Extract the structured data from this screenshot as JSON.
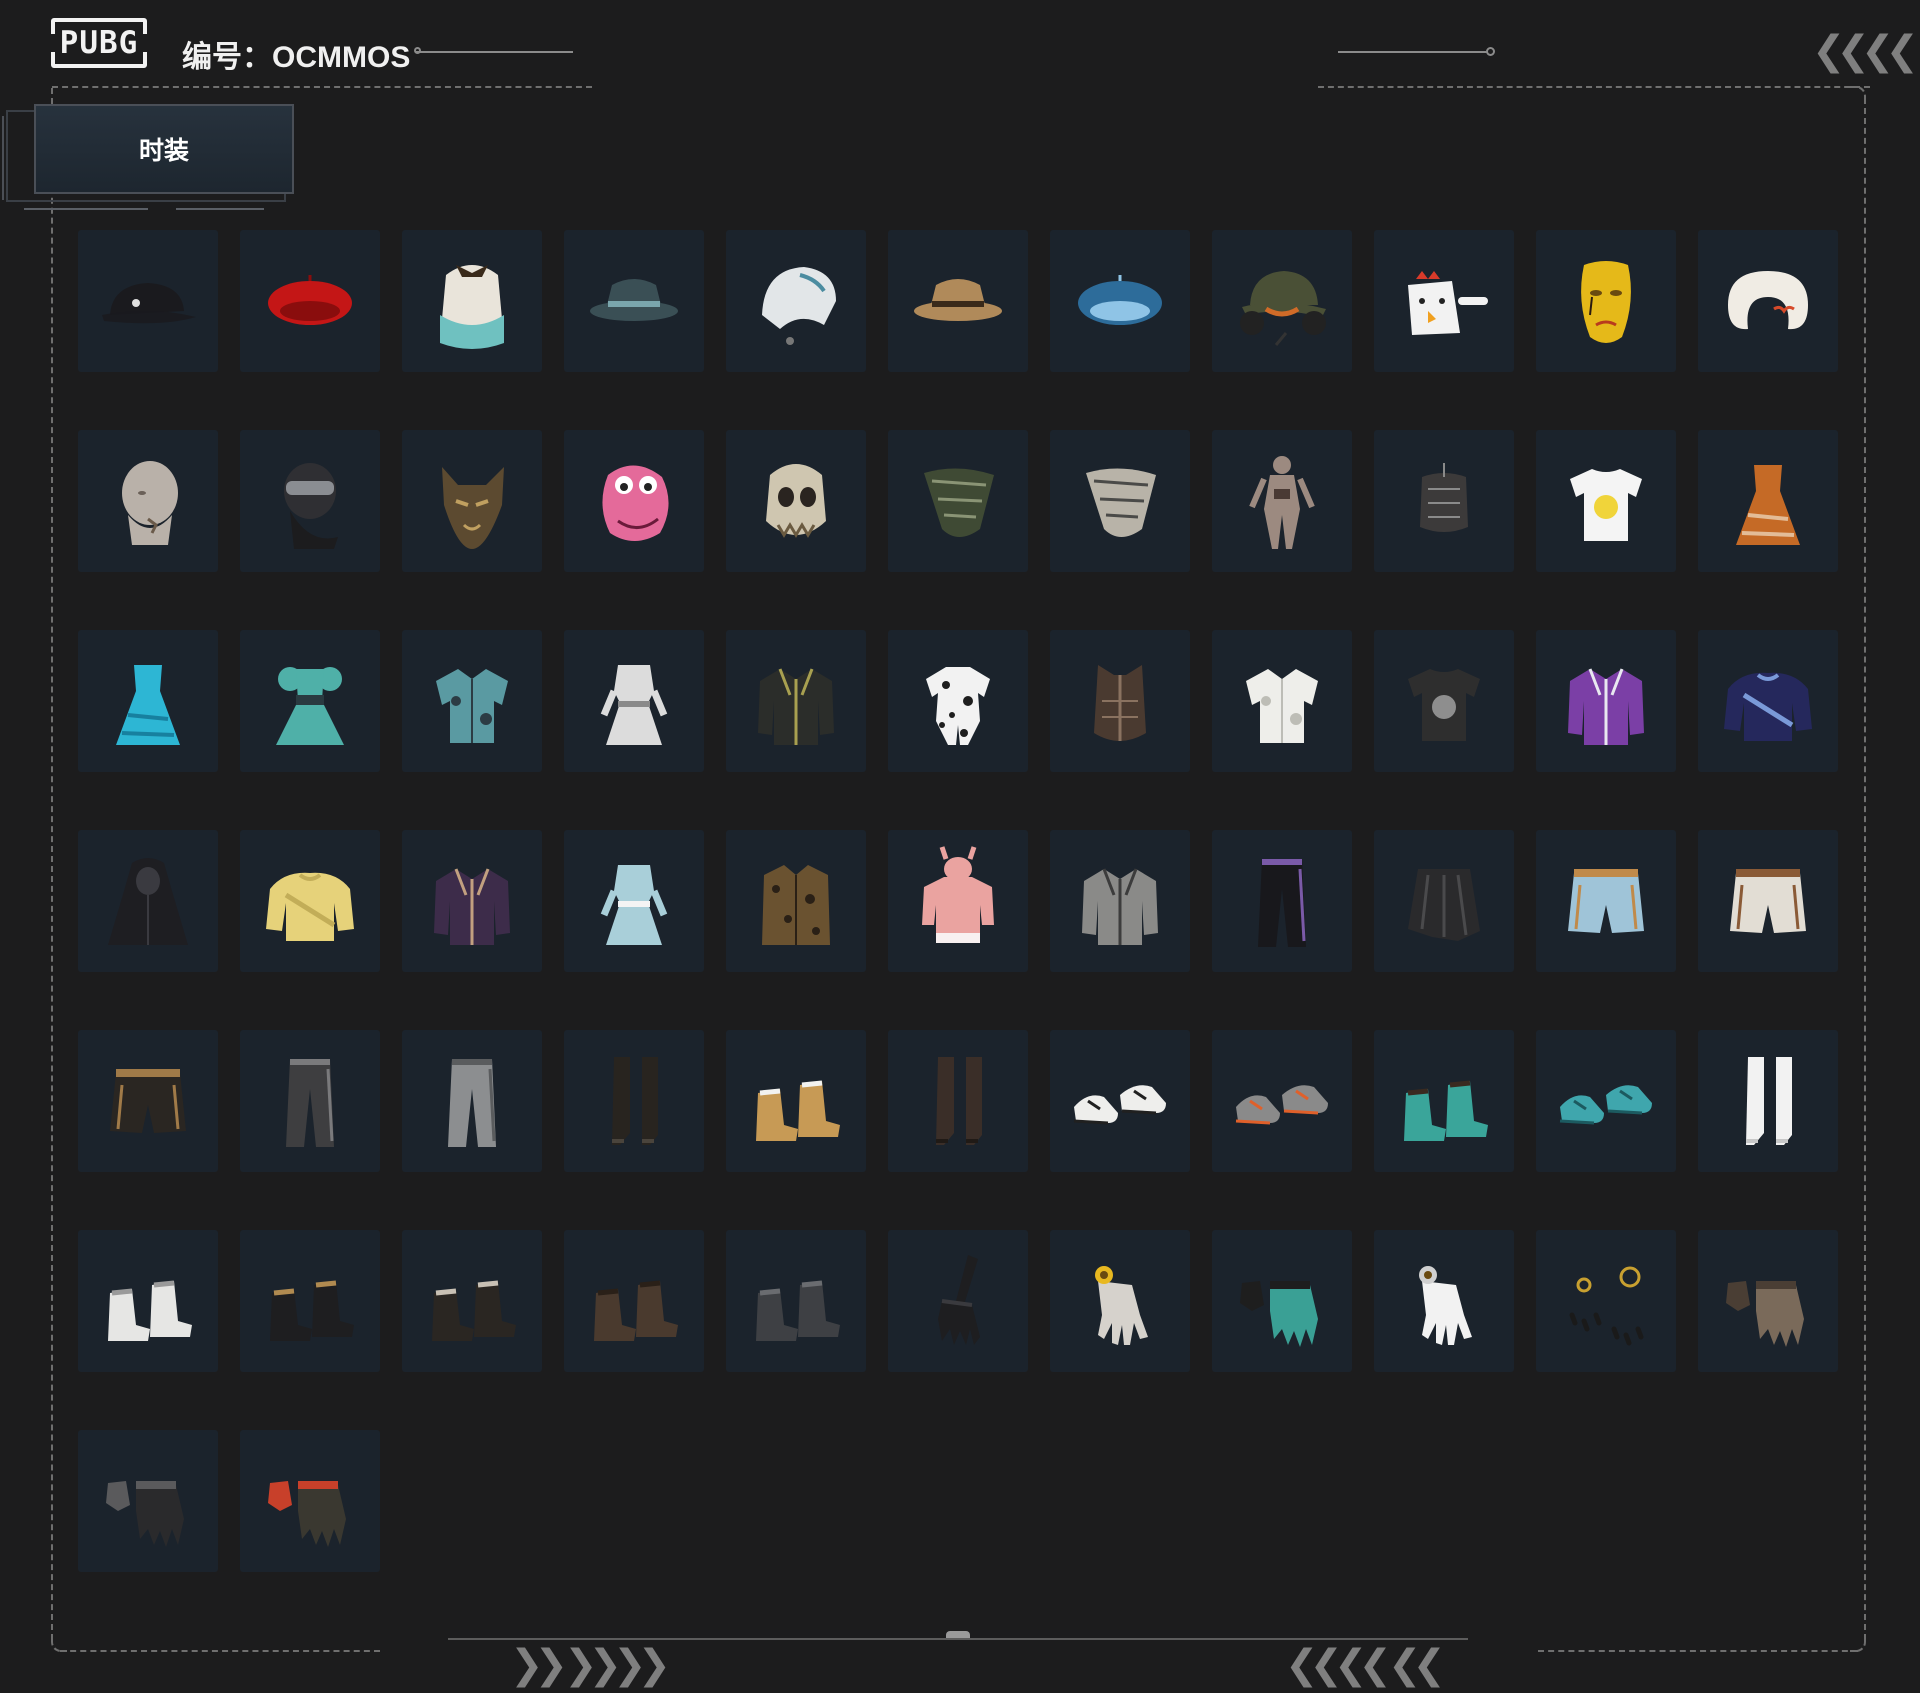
{
  "header": {
    "logo_text": "PUBG",
    "code_label": "编号：OCMMOS"
  },
  "category_tab": {
    "label": "时装"
  },
  "colors": {
    "background": "#1c1c1d",
    "tile": "#1b232c",
    "frame_dash": "#6f6f6f",
    "tab_gradient_top": "#27323d",
    "tab_gradient_bottom": "#1d262f"
  },
  "items": [
    {
      "name": "black-baseball-cap",
      "icon": "cap",
      "color": "#1a1a1e",
      "accent": "#e0e0e0"
    },
    {
      "name": "red-beret",
      "icon": "beret",
      "color": "#c41616",
      "accent": "#8a0d0d"
    },
    {
      "name": "teal-fluffy-hair-with-bow",
      "icon": "hair",
      "color": "#6fc1c0",
      "accent": "#e9e4da"
    },
    {
      "name": "teal-bucket-hat",
      "icon": "bucket",
      "color": "#3a4f55",
      "accent": "#7aa6ad"
    },
    {
      "name": "white-hood",
      "icon": "hood",
      "color": "#e2e6e8",
      "accent": "#4b8ca0"
    },
    {
      "name": "leopard-bucket-hat",
      "icon": "bucket",
      "color": "#b08a5a",
      "accent": "#3a2a1a"
    },
    {
      "name": "blue-plaid-beret",
      "icon": "beret",
      "color": "#2d6c9a",
      "accent": "#8fc4e6"
    },
    {
      "name": "army-cap-headset",
      "icon": "headset",
      "color": "#4a5036",
      "accent": "#d06b28"
    },
    {
      "name": "white-chicken-mask",
      "icon": "chicken",
      "color": "#f2f2f2",
      "accent": "#d83a2a"
    },
    {
      "name": "gold-face-mask",
      "icon": "mask",
      "color": "#e5b919",
      "accent": "#b83b1d"
    },
    {
      "name": "white-neck-pillow",
      "icon": "pillow",
      "color": "#f0ece4",
      "accent": "#d64a2a"
    },
    {
      "name": "bald-head-with-goatee",
      "icon": "head",
      "color": "#b9b1a9",
      "accent": "#6a5a4a"
    },
    {
      "name": "dark-goggles-balaclava",
      "icon": "balaclava",
      "color": "#2f2f33",
      "accent": "#8a8d92"
    },
    {
      "name": "bronze-wolf-mask",
      "icon": "wolf",
      "color": "#5c4a30",
      "accent": "#c0a060"
    },
    {
      "name": "pink-dino-mask",
      "icon": "dino",
      "color": "#e46a9a",
      "accent": "#ffffff"
    },
    {
      "name": "skeleton-warrior-mask",
      "icon": "skull",
      "color": "#cfc6b0",
      "accent": "#6a5a40"
    },
    {
      "name": "green-camo-bandana",
      "icon": "bandana",
      "color": "#3f4a34",
      "accent": "#8a9475"
    },
    {
      "name": "checkered-scarf",
      "icon": "bandana",
      "color": "#b8b3a8",
      "accent": "#4a4a48"
    },
    {
      "name": "hooded-bodysuit",
      "icon": "bodysuit",
      "color": "#9c8a80",
      "accent": "#4a3a34"
    },
    {
      "name": "dark-leather-corset",
      "icon": "corset",
      "color": "#3c3a3a",
      "accent": "#8a8a8a"
    },
    {
      "name": "white-chick-tshirt",
      "icon": "tshirt",
      "color": "#f4f4f4",
      "accent": "#f0d43a"
    },
    {
      "name": "orange-leopard-dress",
      "icon": "dress",
      "color": "#c56a26",
      "accent": "#f0e0c8"
    },
    {
      "name": "blue-tie-dye-dress",
      "icon": "dress",
      "color": "#2db6d4",
      "accent": "#0e6a8a"
    },
    {
      "name": "teal-puff-sleeve-dress",
      "icon": "puffdress",
      "color": "#4fb0a8",
      "accent": "#2a3a40"
    },
    {
      "name": "tropical-print-shirt",
      "icon": "shirt",
      "color": "#5a9aa2",
      "accent": "#2c3c44"
    },
    {
      "name": "white-sci-fi-dress",
      "icon": "scidress",
      "color": "#dcdcdc",
      "accent": "#8a8a8a"
    },
    {
      "name": "black-military-jacket",
      "icon": "jacket",
      "color": "#2b2d2a",
      "accent": "#a8a050"
    },
    {
      "name": "dalmatian-outfit",
      "icon": "romper",
      "color": "#f2f2f2",
      "accent": "#1e1e1e"
    },
    {
      "name": "brown-leather-vest",
      "icon": "vest",
      "color": "#4a3a30",
      "accent": "#8a7260"
    },
    {
      "name": "white-mandarin-shirt",
      "icon": "shirt",
      "color": "#eeeeea",
      "accent": "#bdbdb6"
    },
    {
      "name": "winner-winner-tshirt",
      "icon": "tshirt",
      "color": "#2e2e2e",
      "accent": "#8e8e8e"
    },
    {
      "name": "purple-colorblock-jacket",
      "icon": "jacket",
      "color": "#7b3fa6",
      "accent": "#e8e8f0"
    },
    {
      "name": "navy-anniversary-sweater",
      "icon": "sweater",
      "color": "#25285c",
      "accent": "#7a9ad8"
    },
    {
      "name": "black-hooded-cloak",
      "icon": "cloak",
      "color": "#1e1e22",
      "accent": "#3a3a40"
    },
    {
      "name": "yellow-fuzzy-sweater",
      "icon": "sweater",
      "color": "#e6d27a",
      "accent": "#c2ad58"
    },
    {
      "name": "purple-bomber-jacket",
      "icon": "jacket",
      "color": "#3d2c4a",
      "accent": "#c2a080"
    },
    {
      "name": "light-blue-nurse-dress",
      "icon": "scidress",
      "color": "#a9cfd9",
      "accent": "#f4f4f4"
    },
    {
      "name": "leopard-trench-coat",
      "icon": "coat",
      "color": "#6a5230",
      "accent": "#2a2016"
    },
    {
      "name": "pink-bunny-hoodie",
      "icon": "hoodie",
      "color": "#eaa3a0",
      "accent": "#f8f0f0"
    },
    {
      "name": "grey-denim-jacket",
      "icon": "jacket",
      "color": "#8a8a88",
      "accent": "#3c3c3c"
    },
    {
      "name": "black-track-pants",
      "icon": "pants",
      "color": "#18181c",
      "accent": "#7a5aa8"
    },
    {
      "name": "black-draped-skirt",
      "icon": "skirt",
      "color": "#2a2a2c",
      "accent": "#4a4a4c"
    },
    {
      "name": "light-denim-shorts",
      "icon": "shorts",
      "color": "#9fc4d8",
      "accent": "#c08a4a"
    },
    {
      "name": "white-shorts-belt",
      "icon": "shorts",
      "color": "#e2ddd4",
      "accent": "#8a5a36"
    },
    {
      "name": "leopard-panel-shorts",
      "icon": "shorts",
      "color": "#2a2622",
      "accent": "#a07a48"
    },
    {
      "name": "grey-patched-pants",
      "icon": "pants",
      "color": "#3e3e40",
      "accent": "#7a7a7c"
    },
    {
      "name": "grey-joggers",
      "icon": "pants",
      "color": "#8c8e90",
      "accent": "#5a5c5e"
    },
    {
      "name": "black-thigh-high-boots",
      "icon": "tallboots",
      "color": "#28241f",
      "accent": "#4a443c"
    },
    {
      "name": "tan-work-boots",
      "icon": "boots",
      "color": "#c79a55",
      "accent": "#f2f2f0"
    },
    {
      "name": "black-stocking-heels",
      "icon": "tallboots",
      "color": "#3a2e28",
      "accent": "#201a16"
    },
    {
      "name": "white-platform-sneakers",
      "icon": "sneakers",
      "color": "#eeeeec",
      "accent": "#202020"
    },
    {
      "name": "grey-orange-sneakers",
      "icon": "sneakers",
      "color": "#8a8a8a",
      "accent": "#e0602a"
    },
    {
      "name": "teal-lace-up-boots",
      "icon": "boots",
      "color": "#3aa59a",
      "accent": "#3a2a20"
    },
    {
      "name": "teal-slip-ons",
      "icon": "sneakers",
      "color": "#3fa6ad",
      "accent": "#1c5a60"
    },
    {
      "name": "white-ankle-boots",
      "icon": "tallboots",
      "color": "#f2f2f2",
      "accent": "#c8c8c8"
    },
    {
      "name": "white-slouch-boots",
      "icon": "boots",
      "color": "#e6e6e4",
      "accent": "#9a9a9a"
    },
    {
      "name": "black-fuzzy-leopard-boots",
      "icon": "boots",
      "color": "#1e1e20",
      "accent": "#b08a50"
    },
    {
      "name": "fur-trim-black-boots",
      "icon": "boots",
      "color": "#2a2622",
      "accent": "#c8c0b4"
    },
    {
      "name": "brown-ankle-boots",
      "icon": "boots",
      "color": "#4a3a2e",
      "accent": "#2a2018"
    },
    {
      "name": "dark-grey-boots",
      "icon": "boots",
      "color": "#3e4044",
      "accent": "#6a6c70"
    },
    {
      "name": "black-claw-gloves",
      "icon": "clawgloves",
      "color": "#1e1e20",
      "accent": "#3a3a3e"
    },
    {
      "name": "sunflower-hand",
      "icon": "hand",
      "color": "#d6d2cc",
      "accent": "#e8b820"
    },
    {
      "name": "teal-fingerless-gloves",
      "icon": "gloves",
      "color": "#3aa095",
      "accent": "#1e1e1e"
    },
    {
      "name": "white-gloves",
      "icon": "hand",
      "color": "#f2f2f2",
      "accent": "#d0d0d0"
    },
    {
      "name": "black-nail-jewelry",
      "icon": "nails",
      "color": "#1a1a1a",
      "accent": "#c8a030"
    },
    {
      "name": "bandaged-gloves",
      "icon": "gloves",
      "color": "#7a6a5a",
      "accent": "#4a3e34"
    },
    {
      "name": "black-fingerless-gloves",
      "icon": "gloves",
      "color": "#2a2a2c",
      "accent": "#5a5a5c"
    },
    {
      "name": "superman-gloves",
      "icon": "gloves",
      "color": "#3a3830",
      "accent": "#c8402a"
    }
  ]
}
